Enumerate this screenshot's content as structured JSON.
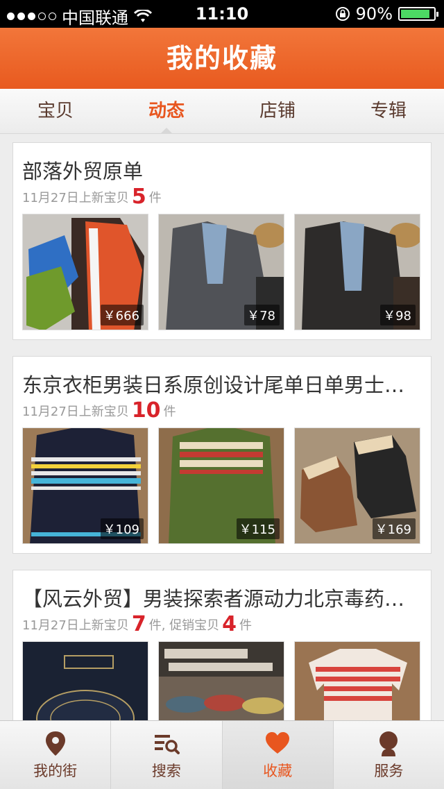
{
  "status_bar": {
    "carrier": "中国联通",
    "time": "11:10",
    "battery": "90%",
    "battery_level": 0.9,
    "signal_bars": 3,
    "signal_total": 5
  },
  "nav": {
    "title": "我的收藏"
  },
  "tabs": [
    {
      "label": "宝贝",
      "active": false
    },
    {
      "label": "动态",
      "active": true
    },
    {
      "label": "店铺",
      "active": false
    },
    {
      "label": "专辑",
      "active": false
    }
  ],
  "cards": [
    {
      "title": "部落外贸原单",
      "meta_prefix": "11月27日上新宝贝",
      "new_count": "5",
      "unit": "件",
      "items": [
        {
          "price": "￥666"
        },
        {
          "price": "￥78"
        },
        {
          "price": "￥98"
        }
      ]
    },
    {
      "title": "东京衣柜男装日系原创设计尾单日单男士…",
      "meta_prefix": "11月27日上新宝贝",
      "new_count": "10",
      "unit": "件",
      "items": [
        {
          "price": "￥109"
        },
        {
          "price": "￥115"
        },
        {
          "price": "￥169"
        }
      ]
    },
    {
      "title": "【风云外贸】男装探索者源动力北京毒药…",
      "meta_prefix": "11月27日上新宝贝",
      "new_count": "7",
      "unit": "件",
      "promo_prefix": ", 促销宝贝",
      "promo_count": "4",
      "promo_unit": "件",
      "items": [
        {
          "price": ""
        },
        {
          "price": ""
        },
        {
          "price": ""
        }
      ]
    }
  ],
  "tab_bar": [
    {
      "label": "我的街",
      "icon": "location-pin-icon",
      "active": false
    },
    {
      "label": "搜索",
      "icon": "search-list-icon",
      "active": false
    },
    {
      "label": "收藏",
      "icon": "heart-icon",
      "active": true
    },
    {
      "label": "服务",
      "icon": "person-icon",
      "active": false
    }
  ],
  "colors": {
    "accent": "#e8561f",
    "price_highlight": "#d8232a",
    "tab_text": "#6b3a2a"
  }
}
